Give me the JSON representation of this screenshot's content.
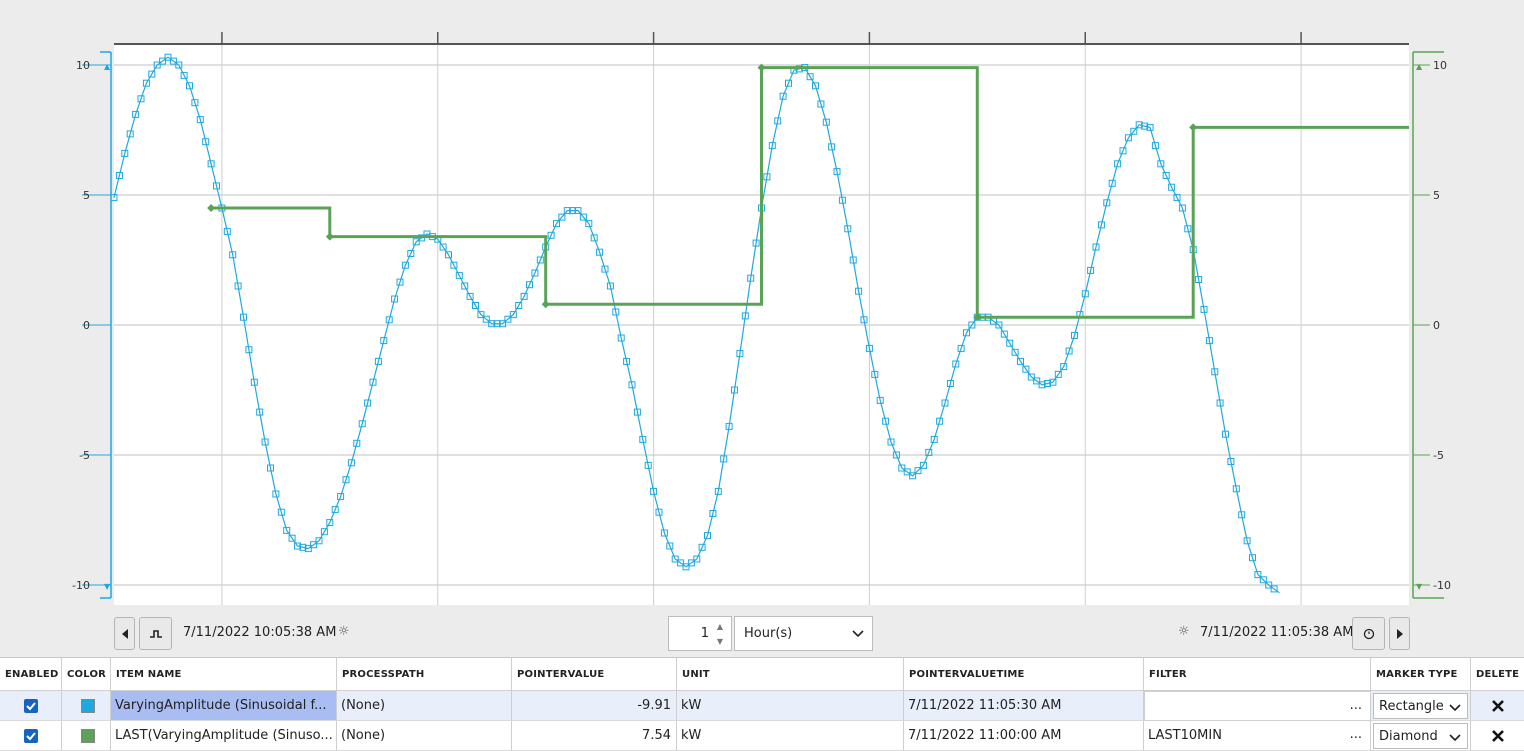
{
  "chart_data": {
    "type": "line",
    "left_axis": {
      "ylim": [
        -10.5,
        10.5
      ],
      "ticks": [
        "10",
        "5",
        "0",
        "-5",
        "-10"
      ],
      "color": "#1fa8e0"
    },
    "right_axis": {
      "ylim": [
        -10.5,
        10.5
      ],
      "ticks": [
        "10",
        "5",
        "0",
        "-5",
        "-10"
      ],
      "color": "#5aa356"
    },
    "x_start": "7/11/2022 10:05:38 AM",
    "x_end": "7/11/2022 11:05:38 AM",
    "grid": true,
    "series": [
      {
        "color": "#1fa8e0",
        "marker": "rectangle",
        "points": [
          [
            0,
            4.9
          ],
          [
            0.5,
            6.6
          ],
          [
            1,
            8.1
          ],
          [
            1.5,
            9.3
          ],
          [
            2,
            10.0
          ],
          [
            2.5,
            10.3
          ],
          [
            3,
            10.0
          ],
          [
            3.5,
            9.2
          ],
          [
            4,
            7.9
          ],
          [
            4.5,
            6.2
          ],
          [
            5,
            4.5
          ],
          [
            5.5,
            2.7
          ],
          [
            6,
            0.3
          ],
          [
            6.5,
            -2.2
          ],
          [
            7,
            -4.5
          ],
          [
            7.5,
            -6.5
          ],
          [
            8,
            -7.9
          ],
          [
            8.5,
            -8.5
          ],
          [
            9,
            -8.6
          ],
          [
            9.5,
            -8.3
          ],
          [
            10,
            -7.6
          ],
          [
            10.5,
            -6.6
          ],
          [
            11,
            -5.3
          ],
          [
            11.5,
            -3.8
          ],
          [
            12,
            -2.2
          ],
          [
            12.5,
            -0.6
          ],
          [
            13,
            1.0
          ],
          [
            13.5,
            2.3
          ],
          [
            14,
            3.2
          ],
          [
            14.5,
            3.5
          ],
          [
            15,
            3.3
          ],
          [
            15.5,
            2.7
          ],
          [
            16,
            1.9
          ],
          [
            16.5,
            1.1
          ],
          [
            17,
            0.4
          ],
          [
            17.5,
            0.05
          ],
          [
            18,
            0.05
          ],
          [
            18.5,
            0.4
          ],
          [
            19,
            1.1
          ],
          [
            19.5,
            2.0
          ],
          [
            20,
            3.0
          ],
          [
            20.5,
            3.9
          ],
          [
            21,
            4.4
          ],
          [
            21.5,
            4.4
          ],
          [
            22,
            3.9
          ],
          [
            22.5,
            2.8
          ],
          [
            23,
            1.5
          ],
          [
            23.5,
            -0.5
          ],
          [
            24,
            -2.3
          ],
          [
            24.5,
            -4.4
          ],
          [
            25,
            -6.4
          ],
          [
            25.5,
            -8.0
          ],
          [
            26,
            -9.0
          ],
          [
            26.5,
            -9.3
          ],
          [
            27,
            -9.0
          ],
          [
            27.5,
            -8.1
          ],
          [
            28,
            -6.4
          ],
          [
            28.5,
            -3.9
          ],
          [
            29,
            -1.1
          ],
          [
            29.5,
            1.8
          ],
          [
            30,
            4.5
          ],
          [
            30.5,
            6.9
          ],
          [
            31,
            8.8
          ],
          [
            31.5,
            9.8
          ],
          [
            32,
            9.9
          ],
          [
            32.5,
            9.2
          ],
          [
            33,
            7.8
          ],
          [
            33.5,
            5.9
          ],
          [
            34,
            3.7
          ],
          [
            34.5,
            1.3
          ],
          [
            35,
            -0.9
          ],
          [
            35.5,
            -2.9
          ],
          [
            36,
            -4.5
          ],
          [
            36.5,
            -5.5
          ],
          [
            37,
            -5.8
          ],
          [
            37.5,
            -5.4
          ],
          [
            38,
            -4.4
          ],
          [
            38.5,
            -3.0
          ],
          [
            39,
            -1.5
          ],
          [
            39.5,
            -0.3
          ],
          [
            40,
            0.3
          ],
          [
            40.5,
            0.3
          ],
          [
            41,
            0.0
          ],
          [
            41.5,
            -0.7
          ],
          [
            42,
            -1.4
          ],
          [
            42.5,
            -2.0
          ],
          [
            43,
            -2.3
          ],
          [
            43.5,
            -2.2
          ],
          [
            44,
            -1.6
          ],
          [
            44.5,
            -0.4
          ],
          [
            45,
            1.2
          ],
          [
            45.5,
            3.0
          ],
          [
            46,
            4.7
          ],
          [
            46.5,
            6.2
          ],
          [
            47,
            7.2
          ],
          [
            47.5,
            7.7
          ],
          [
            48,
            7.6
          ],
          [
            48.5,
            6.2
          ],
          [
            49,
            5.3
          ],
          [
            49.5,
            4.5
          ],
          [
            50,
            2.9
          ],
          [
            50.5,
            0.6
          ],
          [
            51,
            -1.8
          ],
          [
            51.5,
            -4.2
          ],
          [
            52,
            -6.3
          ],
          [
            52.5,
            -8.3
          ],
          [
            53,
            -9.6
          ],
          [
            53.5,
            -10.0
          ],
          [
            54,
            -10.3
          ]
        ]
      },
      {
        "color": "#5aa356",
        "marker": "diamond",
        "step": true,
        "points": [
          [
            4.5,
            4.5
          ],
          [
            10,
            4.5
          ],
          [
            10,
            3.4
          ],
          [
            20,
            3.4
          ],
          [
            20,
            0.8
          ],
          [
            30,
            0.8
          ],
          [
            30,
            9.9
          ],
          [
            40,
            9.9
          ],
          [
            40,
            0.3
          ],
          [
            50,
            0.3
          ],
          [
            50,
            7.6
          ],
          [
            60,
            7.6
          ]
        ]
      }
    ]
  },
  "navigator": {
    "start_time": "7/11/2022 10:05:38 AM",
    "end_time": "7/11/2022 11:05:38 AM",
    "period_value": "1",
    "period_unit": "Hour(s)"
  },
  "grid": {
    "headers": [
      "ENABLED",
      "COLOR",
      "ITEM NAME",
      "PROCESSPATH",
      "POINTERVALUE",
      "UNIT",
      "POINTERVALUETIME",
      "FILTER",
      "MARKER TYPE",
      "DELETE"
    ],
    "rows": [
      {
        "color": "#1fa8e0",
        "item_name": "VaryingAmplitude (Sinusoidal f...",
        "process_path": "(None)",
        "pointer_value": "-9.91",
        "unit": "kW",
        "pointer_value_time": "7/11/2022 11:05:30 AM",
        "filter": "",
        "filter_button": "...",
        "marker_type": "Rectangle"
      },
      {
        "color": "#5aa356",
        "item_name": "LAST(VaryingAmplitude (Sinuso...",
        "process_path": "(None)",
        "pointer_value": "7.54",
        "unit": "kW",
        "pointer_value_time": "7/11/2022 11:00:00 AM",
        "filter": "LAST10MIN",
        "filter_button": "...",
        "marker_type": "Diamond"
      }
    ]
  }
}
